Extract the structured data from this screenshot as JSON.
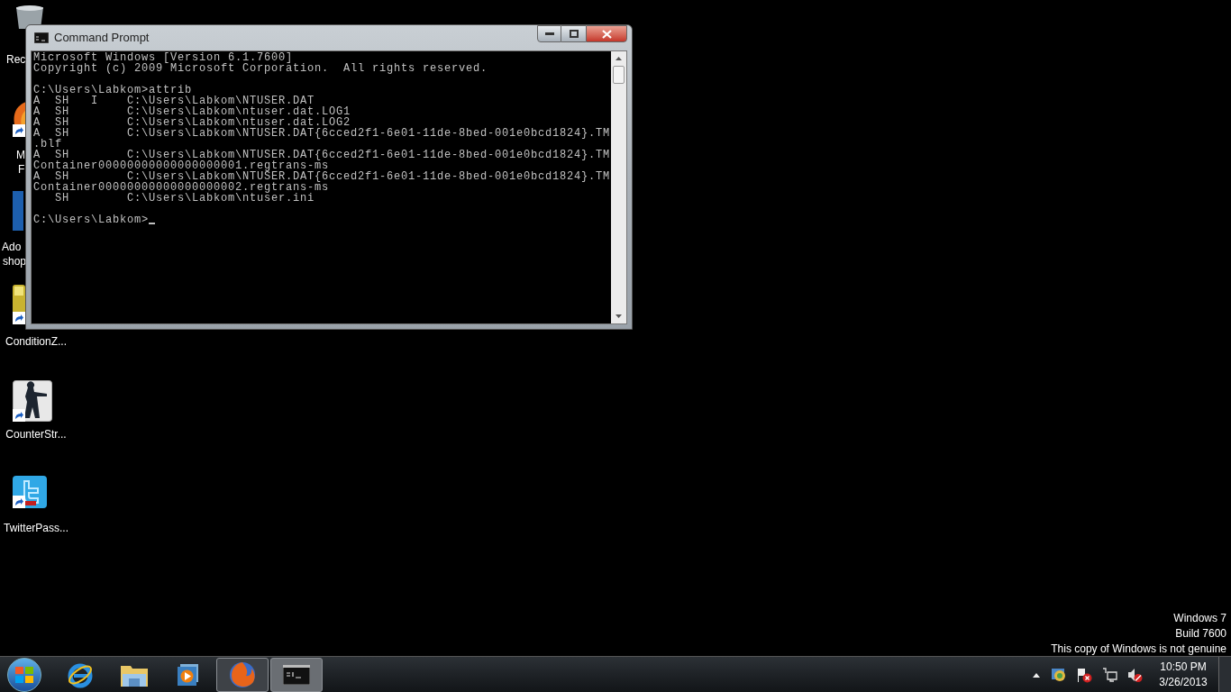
{
  "desktop_icons": [
    {
      "kind": "recycle",
      "label_lines": [
        "Rec"
      ],
      "shortcut": false
    },
    {
      "kind": "firefox",
      "label_lines": [
        "M",
        "F"
      ],
      "shortcut": true
    },
    {
      "kind": "adobe",
      "label_lines": [
        "Ado",
        "shop"
      ],
      "shortcut": false
    },
    {
      "kind": "folder",
      "label_lines": [
        "ConditionZ..."
      ],
      "shortcut": true
    },
    {
      "kind": "soldier",
      "label_lines": [
        "CounterStr..."
      ],
      "shortcut": true
    },
    {
      "kind": "bird",
      "label_lines": [
        "TwitterPass..."
      ],
      "shortcut": true
    }
  ],
  "window": {
    "title": "Command Prompt",
    "console_blocks": [
      [
        "Microsoft Windows [Version 6.1.7600]",
        "Copyright (c) 2009 Microsoft Corporation.  All rights reserved."
      ],
      [
        "C:\\Users\\Labkom>attrib",
        "A  SH   I    C:\\Users\\Labkom\\NTUSER.DAT",
        "A  SH        C:\\Users\\Labkom\\ntuser.dat.LOG1",
        "A  SH        C:\\Users\\Labkom\\ntuser.dat.LOG2",
        "A  SH        C:\\Users\\Labkom\\NTUSER.DAT{6cced2f1-6e01-11de-8bed-001e0bcd1824}.TM",
        ".blf",
        "A  SH        C:\\Users\\Labkom\\NTUSER.DAT{6cced2f1-6e01-11de-8bed-001e0bcd1824}.TM",
        "Container00000000000000000001.regtrans-ms",
        "A  SH        C:\\Users\\Labkom\\NTUSER.DAT{6cced2f1-6e01-11de-8bed-001e0bcd1824}.TM",
        "Container00000000000000000002.regtrans-ms",
        "   SH        C:\\Users\\Labkom\\ntuser.ini"
      ],
      [
        "C:\\Users\\Labkom>"
      ]
    ],
    "cursor_visible": true
  },
  "genuine_notice": [
    "Windows 7",
    "Build 7600",
    "This copy of Windows is not genuine"
  ],
  "taskbar": {
    "items": [
      {
        "kind": "ie",
        "running": false,
        "selected": false
      },
      {
        "kind": "explorer",
        "running": false,
        "selected": false
      },
      {
        "kind": "media",
        "running": false,
        "selected": false
      },
      {
        "kind": "firefox",
        "running": true,
        "selected": false
      },
      {
        "kind": "cmd",
        "running": true,
        "selected": true
      }
    ],
    "clock": {
      "time": "10:50 PM",
      "date": "3/26/2013"
    }
  }
}
